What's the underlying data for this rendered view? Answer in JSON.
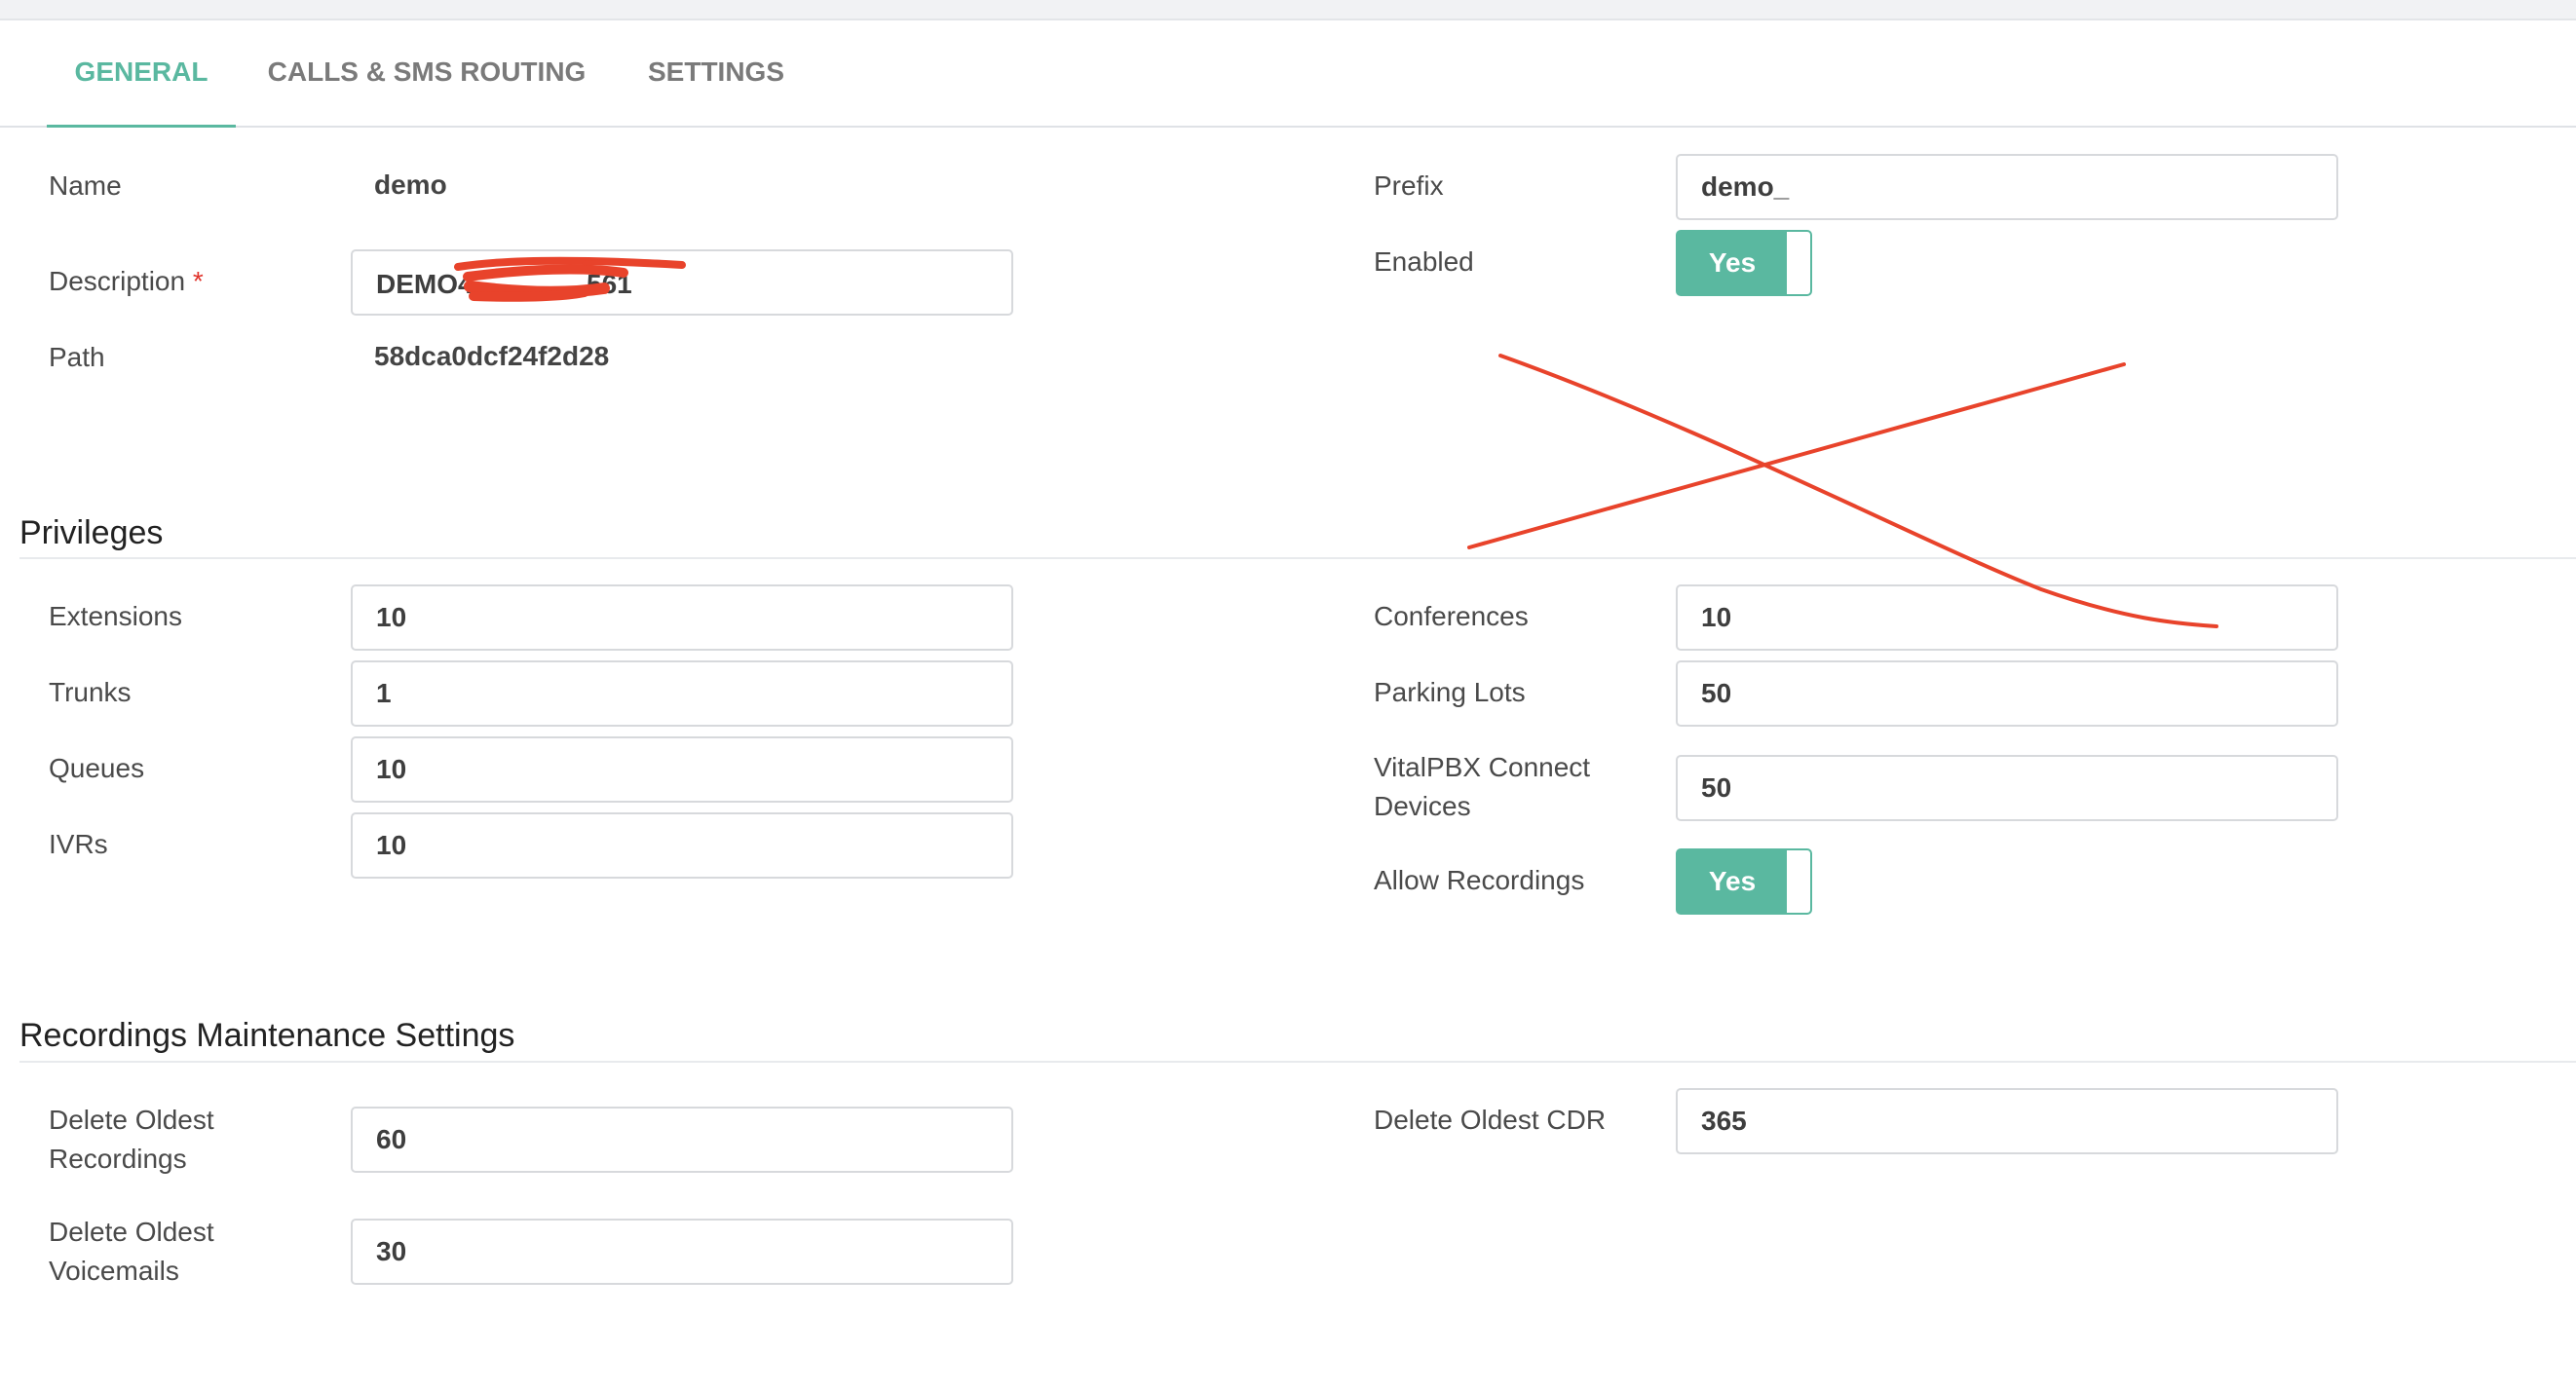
{
  "tabs": [
    {
      "label": "GENERAL"
    },
    {
      "label": "CALLS & SMS ROUTING"
    },
    {
      "label": "SETTINGS"
    }
  ],
  "general": {
    "name_label": "Name",
    "name_value": "demo",
    "description_label": "Description",
    "required_marker": "*",
    "description_value": "DEMO4",
    "description_tail": "561",
    "path_label": "Path",
    "path_value": "58dca0dcf24f2d28",
    "prefix_label": "Prefix",
    "prefix_value": "demo_",
    "enabled_label": "Enabled",
    "enabled_toggle": "Yes"
  },
  "privileges": {
    "title": "Privileges",
    "extensions_label": "Extensions",
    "extensions_value": "10",
    "trunks_label": "Trunks",
    "trunks_value": "1",
    "queues_label": "Queues",
    "queues_value": "10",
    "ivrs_label": "IVRs",
    "ivrs_value": "10",
    "conferences_label": "Conferences",
    "conferences_value": "10",
    "parking_lots_label": "Parking Lots",
    "parking_lots_value": "50",
    "connect_devices_label_1": "VitalPBX Connect",
    "connect_devices_label_2": "Devices",
    "connect_devices_value": "50",
    "allow_recordings_label": "Allow Recordings",
    "allow_recordings_toggle": "Yes"
  },
  "maintenance": {
    "title": "Recordings Maintenance Settings",
    "delete_recordings_label_1": "Delete Oldest",
    "delete_recordings_label_2": "Recordings",
    "delete_recordings_value": "60",
    "delete_voicemails_label_1": "Delete Oldest",
    "delete_voicemails_label_2": "Voicemails",
    "delete_voicemails_value": "30",
    "delete_cdr_label": "Delete Oldest CDR",
    "delete_cdr_value": "365"
  },
  "colors": {
    "accent": "#5ab8a0",
    "annotation_red": "#e8432b",
    "required_red": "#e0332b"
  }
}
